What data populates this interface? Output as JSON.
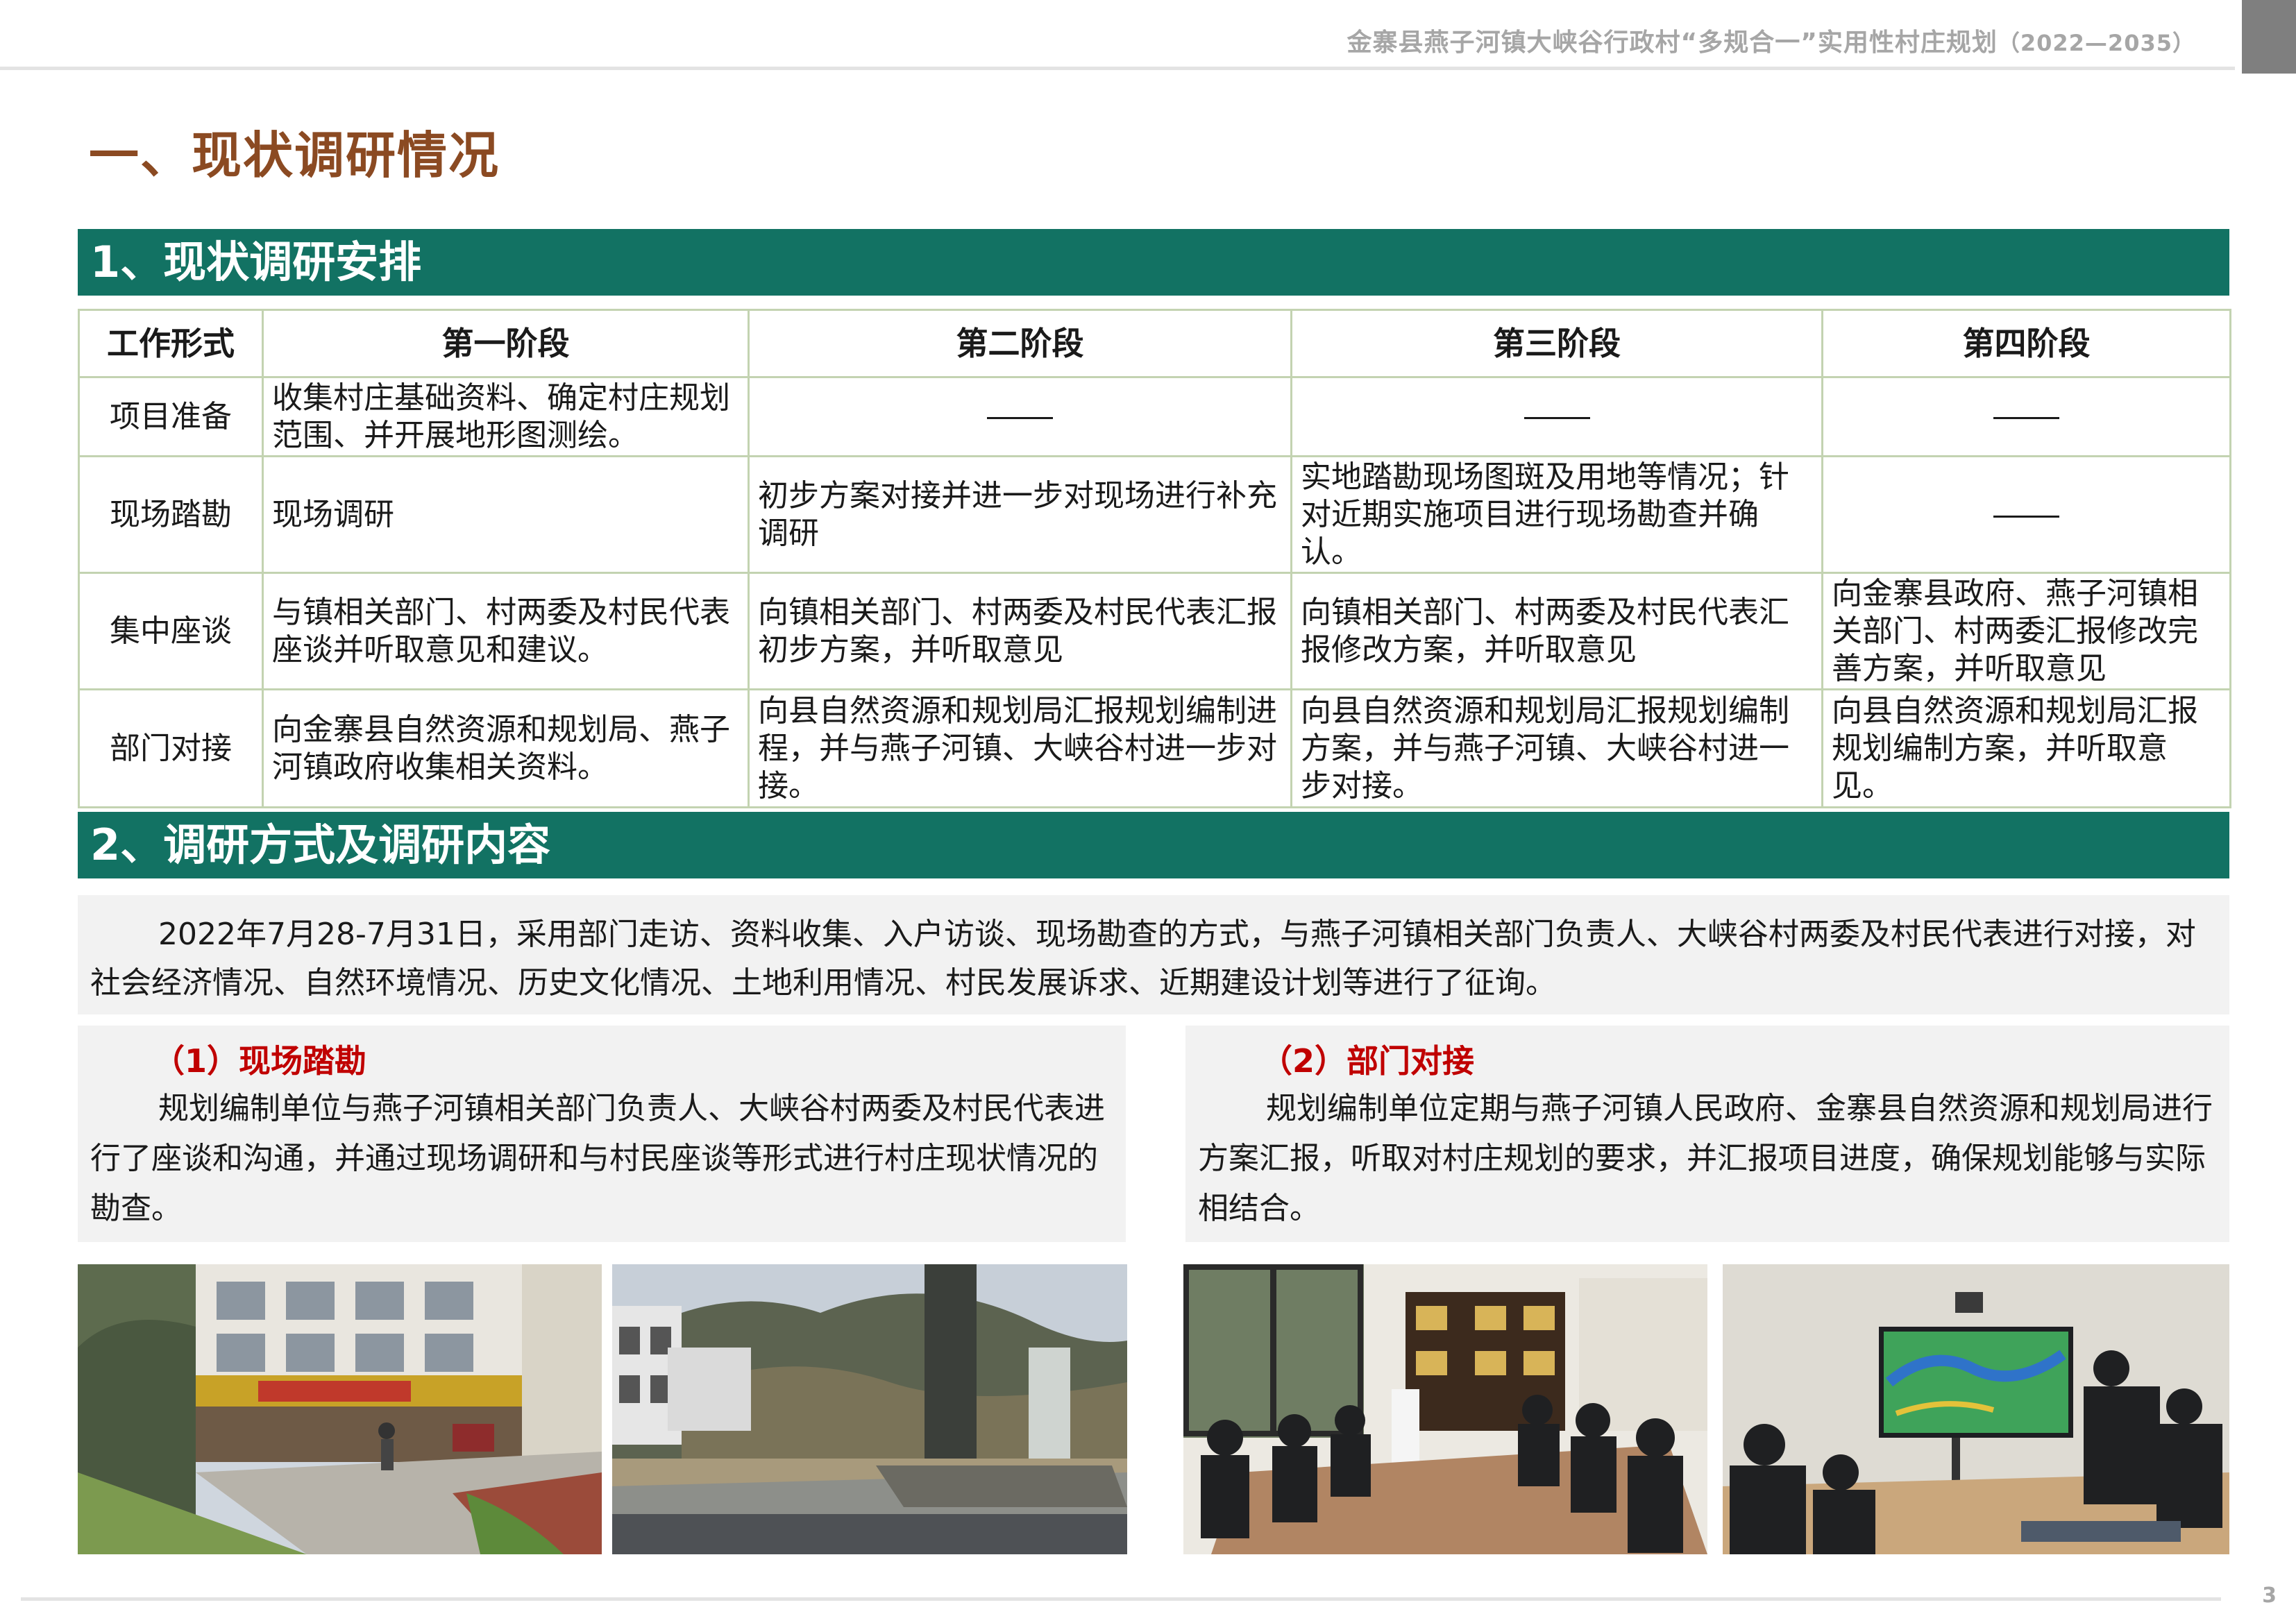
{
  "header": {
    "title": "金寨县燕子河镇大峡谷行政村“多规合一”实用性村庄规划",
    "years": "（2022—2035）"
  },
  "main_title": "一、现状调研情况",
  "section1": {
    "title": "1、现状调研安排",
    "table": {
      "headers": [
        "工作形式",
        "第一阶段",
        "第二阶段",
        "第三阶段",
        "第四阶段"
      ],
      "rows": [
        {
          "form": "项目准备",
          "cells": [
            "收集村庄基础资料、确定村庄规划范围、并开展地形图测绘。",
            "",
            "",
            ""
          ]
        },
        {
          "form": "现场踏勘",
          "cells": [
            "现场调研",
            "初步方案对接并进一步对现场进行补充调研",
            "实地踏勘现场图斑及用地等情况；针对近期实施项目进行现场勘查并确认。",
            ""
          ]
        },
        {
          "form": "集中座谈",
          "cells": [
            "与镇相关部门、村两委及村民代表座谈并听取意见和建议。",
            "向镇相关部门、村两委及村民代表汇报初步方案，并听取意见",
            "向镇相关部门、村两委及村民代表汇报修改方案，并听取意见",
            "向金寨县政府、燕子河镇相关部门、村两委汇报修改完善方案，并听取意见"
          ]
        },
        {
          "form": "部门对接",
          "cells": [
            "向金寨县自然资源和规划局、燕子河镇政府收集相关资料。",
            "向县自然资源和规划局汇报规划编制进程，并与燕子河镇、大峡谷村进一步对接。",
            "向县自然资源和规划局汇报规划编制方案，并与燕子河镇、大峡谷村进一步对接。",
            "向县自然资源和规划局汇报规划编制方案，并听取意见。"
          ]
        }
      ]
    }
  },
  "section2": {
    "title": "2、调研方式及调研内容",
    "intro": "2022年7月28-7月31日，采用部门走访、资料收集、入户访谈、现场勘查的方式，与燕子河镇相关部门负责人、大峡谷村两委及村民代表进行对接，对社会经济情况、自然环境情况、历史文化情况、土地利用情况、村民发展诉求、近期建设计划等进行了征询。",
    "left": {
      "heading": "（1）现场踏勘",
      "text": "规划编制单位与燕子河镇相关部门负责人、大峡谷村两委及村民代表进行了座谈和沟通，并通过现场调研和与村民座谈等形式进行村庄现状情况的勘查。"
    },
    "right": {
      "heading": "（2）部门对接",
      "text": "规划编制单位定期与燕子河镇人民政府、金寨县自然资源和规划局进行方案汇报，听取对村庄规划的要求，并汇报项目进度，确保规划能够与实际相结合。"
    }
  },
  "page_number": "3",
  "colors": {
    "section_bar": "#127263",
    "main_title": "#8b4a22",
    "sub_heading": "#c00000",
    "table_border": "#c3d3b1"
  }
}
